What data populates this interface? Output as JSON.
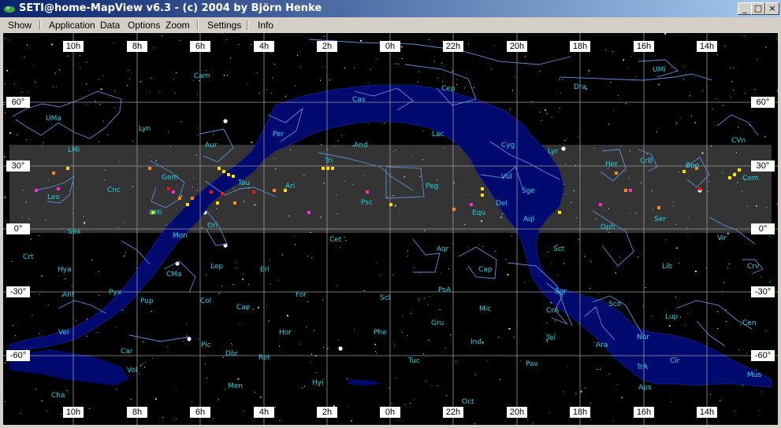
{
  "window": {
    "title": "SETI@home-MapView v6.3 - (c) 2004 by Björn Henke",
    "minimize_glyph": "_",
    "maximize_glyph": "□",
    "close_glyph": "×"
  },
  "menu": {
    "show": "Show",
    "application": "Application",
    "data": "Data",
    "options": "Options",
    "zoom": "Zoom",
    "settings": "Settings",
    "info": "Info"
  },
  "hours": [
    "10h",
    "8h",
    "6h",
    "4h",
    "2h",
    "0h",
    "22h",
    "20h",
    "18h",
    "16h",
    "14h"
  ],
  "declinations": {
    "d60": "60°",
    "d30": "30°",
    "d0": "0°",
    "dm30": "-30°",
    "dm60": "-60°"
  },
  "constellations": [
    "Cam",
    "UMa",
    "Lyn",
    "LMi",
    "Cnc",
    "Leo",
    "Gem",
    "CMi",
    "Sex",
    "Mon",
    "Ori",
    "Crt",
    "Hya",
    "Ant",
    "Pyx",
    "CMa",
    "Lep",
    "Eri",
    "Pup",
    "Col",
    "Cae",
    "Vel",
    "Car",
    "Pic",
    "Hor",
    "Dor",
    "Ret",
    "Vol",
    "Cha",
    "Men",
    "Hyi",
    "Aur",
    "Tau",
    "Per",
    "Ari",
    "Tri",
    "Cas",
    "And",
    "Psc",
    "Cet",
    "For",
    "Scl",
    "Phe",
    "PsA",
    "Gru",
    "Ind",
    "Tuc",
    "Oct",
    "Pav",
    "Tel",
    "CrA",
    "Sgr",
    "Aqr",
    "Cap",
    "Mic",
    "Peg",
    "Lac",
    "Cep",
    "Cyg",
    "Vul",
    "Sge",
    "Equ",
    "Del",
    "Aql",
    "Lyr",
    "Dra",
    "UMi",
    "Her",
    "CrB",
    "Oph",
    "Ser",
    "Sct",
    "Boo",
    "Com",
    "CVn",
    "Vir",
    "Crv",
    "Lib",
    "Sco",
    "Lup",
    "Ara",
    "Nor",
    "Cir",
    "TrA",
    "Aps",
    "Cen",
    "Mus"
  ],
  "colors": {
    "milky_way": "#000a6e",
    "constellation_lines": "#5a8fd6",
    "grid": "#9a9a9a",
    "band": "#3a3a3a",
    "label": "#19d6e6",
    "title_gradient_start": "#0a246a",
    "title_gradient_end": "#a6caf0",
    "workunit_yellow": "#ffe000",
    "workunit_orange": "#ff8a1a",
    "workunit_magenta": "#ff2ad4",
    "workunit_red": "#ff1010"
  }
}
